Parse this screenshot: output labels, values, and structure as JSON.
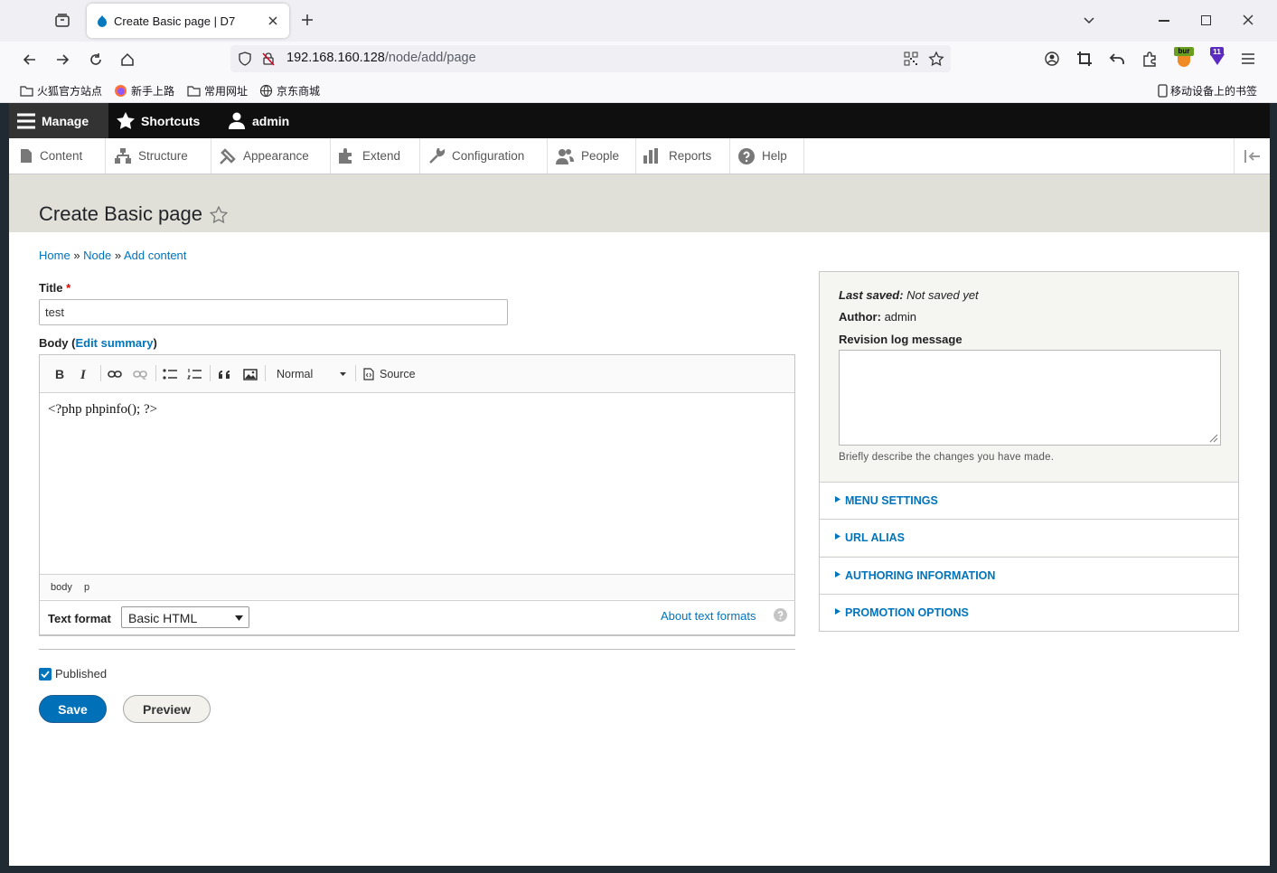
{
  "browser": {
    "tab_title": "Create Basic page | D7",
    "url_host": "192.168.160.128",
    "url_path": "/node/add/page",
    "bookmarks": [
      {
        "label": "火狐官方站点",
        "icon": "folder-icon"
      },
      {
        "label": "新手上路",
        "icon": "firefox-icon"
      },
      {
        "label": "常用网址",
        "icon": "folder-icon"
      },
      {
        "label": "京东商城",
        "icon": "globe-icon"
      }
    ],
    "mobile_bookmarks": "移动设备上的书签",
    "extension_badge_bur": "bur",
    "extension_badge_count": "11"
  },
  "toolbar": {
    "manage": "Manage",
    "shortcuts": "Shortcuts",
    "user": "admin"
  },
  "tray": [
    {
      "label": "Content",
      "icon": "content-icon"
    },
    {
      "label": "Structure",
      "icon": "structure-icon"
    },
    {
      "label": "Appearance",
      "icon": "appearance-icon"
    },
    {
      "label": "Extend",
      "icon": "extend-icon"
    },
    {
      "label": "Configuration",
      "icon": "wrench-icon"
    },
    {
      "label": "People",
      "icon": "people-icon"
    },
    {
      "label": "Reports",
      "icon": "reports-icon"
    },
    {
      "label": "Help",
      "icon": "help-icon"
    }
  ],
  "page": {
    "title": "Create Basic page",
    "breadcrumb": [
      "Home",
      "Node",
      "Add content"
    ],
    "breadcrumb_sep": "»"
  },
  "form": {
    "title_label": "Title",
    "required_mark": "*",
    "title_value": "test",
    "body_label": "Body",
    "edit_summary": "Edit summary",
    "editor_format_select": "Normal",
    "editor_source": "Source",
    "body_value": "<?php phpinfo(); ?>",
    "path": [
      "body",
      "p"
    ],
    "text_format_label": "Text format",
    "text_format_value": "Basic HTML",
    "about_text_formats": "About text formats",
    "published_label": "Published",
    "published_checked": true,
    "save": "Save",
    "preview": "Preview"
  },
  "sidebar": {
    "last_saved_label": "Last saved:",
    "last_saved_value": "Not saved yet",
    "author_label": "Author:",
    "author_value": "admin",
    "revision_label": "Revision log message",
    "revision_help": "Briefly describe the changes you have made.",
    "sections": [
      "Menu settings",
      "URL alias",
      "Authoring information",
      "Promotion options"
    ]
  },
  "colors": {
    "link": "#0074bd",
    "toolbar_bg": "#0f0f0f",
    "save_button": "#0071b8",
    "required": "#e00000"
  }
}
